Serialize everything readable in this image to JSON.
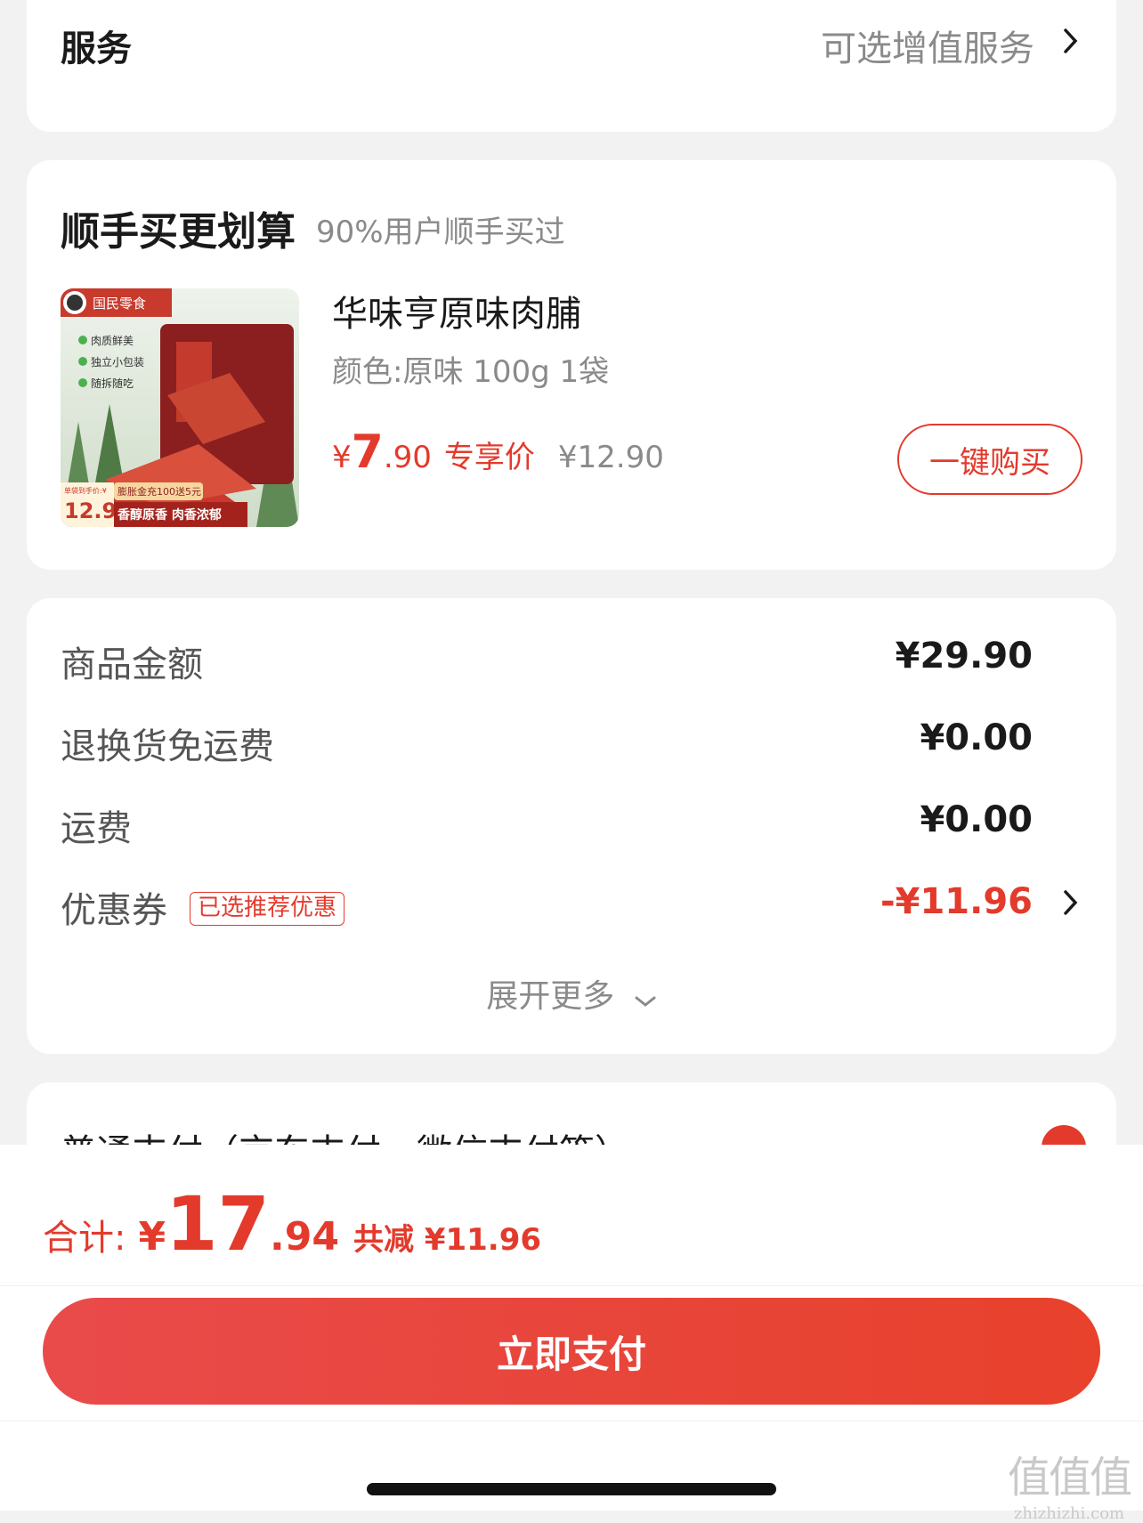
{
  "service": {
    "title": "服务",
    "value": "可选增值服务"
  },
  "upsell": {
    "title": "顺手买更划算",
    "subtitle": "90%用户顺手买过",
    "product": {
      "name": "华味亨原味肉脯",
      "spec": "颜色:原味 100g 1袋",
      "price_currency": "¥",
      "price_int": "7",
      "price_dec": ".90",
      "price_tag": "专享价",
      "original_price": "¥12.90",
      "buy_label": "一键购买",
      "image_texts": {
        "brand": "国民零食",
        "feature1": "肉质鲜美",
        "feature2": "独立小包装",
        "feature3": "随拆随吃",
        "price_note": "单袋到手价:¥",
        "price_big": "12.9",
        "promo": "膨胀金充100送5元",
        "slogan": "香醇原香 肉香浓郁"
      }
    }
  },
  "amounts": {
    "rows": [
      {
        "label": "商品金额",
        "value": "¥29.90"
      },
      {
        "label": "退换货免运费",
        "value": "¥0.00"
      },
      {
        "label": "运费",
        "value": "¥0.00"
      },
      {
        "label": "优惠券",
        "value": "-¥11.96"
      }
    ],
    "coupon_badge": "已选推荐优惠",
    "expand_label": "展开更多"
  },
  "payment": {
    "label": "普通支付（京东支付、微信支付等）"
  },
  "bottom": {
    "total_label": "合计:",
    "total_currency": "¥",
    "total_int": "17",
    "total_dec": ".94",
    "discount": "共减 ¥11.96",
    "pay_button": "立即支付"
  },
  "watermark": {
    "logo": "值值值",
    "url": "zhizhizhi.com"
  },
  "colors": {
    "accent": "#e33a2c",
    "muted": "#8a8a8a",
    "background": "#f2f2f2"
  }
}
